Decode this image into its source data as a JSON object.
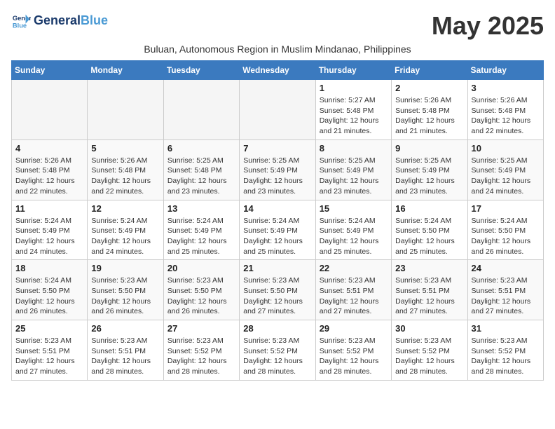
{
  "header": {
    "logo_line1": "General",
    "logo_line2": "Blue",
    "month_title": "May 2025",
    "subtitle": "Buluan, Autonomous Region in Muslim Mindanao, Philippines"
  },
  "weekdays": [
    "Sunday",
    "Monday",
    "Tuesday",
    "Wednesday",
    "Thursday",
    "Friday",
    "Saturday"
  ],
  "weeks": [
    [
      {
        "day": "",
        "empty": true
      },
      {
        "day": "",
        "empty": true
      },
      {
        "day": "",
        "empty": true
      },
      {
        "day": "",
        "empty": true
      },
      {
        "day": "1",
        "sunrise": "5:27 AM",
        "sunset": "5:48 PM",
        "daylight": "12 hours and 21 minutes."
      },
      {
        "day": "2",
        "sunrise": "5:26 AM",
        "sunset": "5:48 PM",
        "daylight": "12 hours and 21 minutes."
      },
      {
        "day": "3",
        "sunrise": "5:26 AM",
        "sunset": "5:48 PM",
        "daylight": "12 hours and 22 minutes."
      }
    ],
    [
      {
        "day": "4",
        "sunrise": "5:26 AM",
        "sunset": "5:48 PM",
        "daylight": "12 hours and 22 minutes."
      },
      {
        "day": "5",
        "sunrise": "5:26 AM",
        "sunset": "5:48 PM",
        "daylight": "12 hours and 22 minutes."
      },
      {
        "day": "6",
        "sunrise": "5:25 AM",
        "sunset": "5:48 PM",
        "daylight": "12 hours and 23 minutes."
      },
      {
        "day": "7",
        "sunrise": "5:25 AM",
        "sunset": "5:49 PM",
        "daylight": "12 hours and 23 minutes."
      },
      {
        "day": "8",
        "sunrise": "5:25 AM",
        "sunset": "5:49 PM",
        "daylight": "12 hours and 23 minutes."
      },
      {
        "day": "9",
        "sunrise": "5:25 AM",
        "sunset": "5:49 PM",
        "daylight": "12 hours and 23 minutes."
      },
      {
        "day": "10",
        "sunrise": "5:25 AM",
        "sunset": "5:49 PM",
        "daylight": "12 hours and 24 minutes."
      }
    ],
    [
      {
        "day": "11",
        "sunrise": "5:24 AM",
        "sunset": "5:49 PM",
        "daylight": "12 hours and 24 minutes."
      },
      {
        "day": "12",
        "sunrise": "5:24 AM",
        "sunset": "5:49 PM",
        "daylight": "12 hours and 24 minutes."
      },
      {
        "day": "13",
        "sunrise": "5:24 AM",
        "sunset": "5:49 PM",
        "daylight": "12 hours and 25 minutes."
      },
      {
        "day": "14",
        "sunrise": "5:24 AM",
        "sunset": "5:49 PM",
        "daylight": "12 hours and 25 minutes."
      },
      {
        "day": "15",
        "sunrise": "5:24 AM",
        "sunset": "5:49 PM",
        "daylight": "12 hours and 25 minutes."
      },
      {
        "day": "16",
        "sunrise": "5:24 AM",
        "sunset": "5:50 PM",
        "daylight": "12 hours and 25 minutes."
      },
      {
        "day": "17",
        "sunrise": "5:24 AM",
        "sunset": "5:50 PM",
        "daylight": "12 hours and 26 minutes."
      }
    ],
    [
      {
        "day": "18",
        "sunrise": "5:24 AM",
        "sunset": "5:50 PM",
        "daylight": "12 hours and 26 minutes."
      },
      {
        "day": "19",
        "sunrise": "5:23 AM",
        "sunset": "5:50 PM",
        "daylight": "12 hours and 26 minutes."
      },
      {
        "day": "20",
        "sunrise": "5:23 AM",
        "sunset": "5:50 PM",
        "daylight": "12 hours and 26 minutes."
      },
      {
        "day": "21",
        "sunrise": "5:23 AM",
        "sunset": "5:50 PM",
        "daylight": "12 hours and 27 minutes."
      },
      {
        "day": "22",
        "sunrise": "5:23 AM",
        "sunset": "5:51 PM",
        "daylight": "12 hours and 27 minutes."
      },
      {
        "day": "23",
        "sunrise": "5:23 AM",
        "sunset": "5:51 PM",
        "daylight": "12 hours and 27 minutes."
      },
      {
        "day": "24",
        "sunrise": "5:23 AM",
        "sunset": "5:51 PM",
        "daylight": "12 hours and 27 minutes."
      }
    ],
    [
      {
        "day": "25",
        "sunrise": "5:23 AM",
        "sunset": "5:51 PM",
        "daylight": "12 hours and 27 minutes."
      },
      {
        "day": "26",
        "sunrise": "5:23 AM",
        "sunset": "5:51 PM",
        "daylight": "12 hours and 28 minutes."
      },
      {
        "day": "27",
        "sunrise": "5:23 AM",
        "sunset": "5:52 PM",
        "daylight": "12 hours and 28 minutes."
      },
      {
        "day": "28",
        "sunrise": "5:23 AM",
        "sunset": "5:52 PM",
        "daylight": "12 hours and 28 minutes."
      },
      {
        "day": "29",
        "sunrise": "5:23 AM",
        "sunset": "5:52 PM",
        "daylight": "12 hours and 28 minutes."
      },
      {
        "day": "30",
        "sunrise": "5:23 AM",
        "sunset": "5:52 PM",
        "daylight": "12 hours and 28 minutes."
      },
      {
        "day": "31",
        "sunrise": "5:23 AM",
        "sunset": "5:52 PM",
        "daylight": "12 hours and 28 minutes."
      }
    ]
  ]
}
